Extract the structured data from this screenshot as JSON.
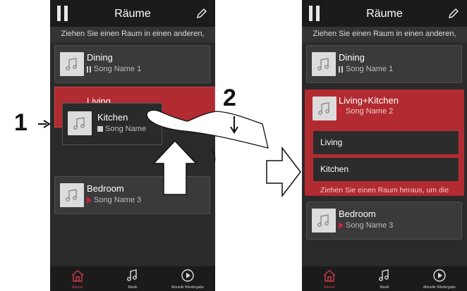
{
  "header": {
    "title": "Räume"
  },
  "left_screen": {
    "hint": "Ziehen Sie einen Raum in einen anderen,",
    "rooms": [
      {
        "name": "Dining",
        "song": "Song Name 1",
        "status": "pause"
      },
      {
        "name": "Living"
      },
      {
        "name": "Kitchen",
        "song": "Song Name",
        "status": "stop"
      },
      {
        "name": "Bedroom",
        "song": "Song Name 3",
        "status": "play"
      }
    ]
  },
  "right_screen": {
    "hint": "Ziehen Sie einen Raum in einen anderen,",
    "rooms": [
      {
        "name": "Dining",
        "song": "Song Name 1",
        "status": "pause"
      },
      {
        "name": "Living+Kitchen",
        "song": "Song Name 2",
        "status": "play"
      },
      {
        "name": "Bedroom",
        "song": "Song Name 3",
        "status": "play"
      }
    ],
    "sub_rooms": [
      "Living",
      "Kitchen"
    ],
    "group_hint": "Ziehen Sie einen Raum heraus, um die"
  },
  "footer": {
    "tabs": [
      "Räume",
      "Musik",
      "Aktuelle Wiedergabe"
    ]
  },
  "callouts": {
    "step1": "1",
    "step2": "2"
  },
  "colors": {
    "accent": "#b22b31",
    "play": "#d11e3a"
  }
}
